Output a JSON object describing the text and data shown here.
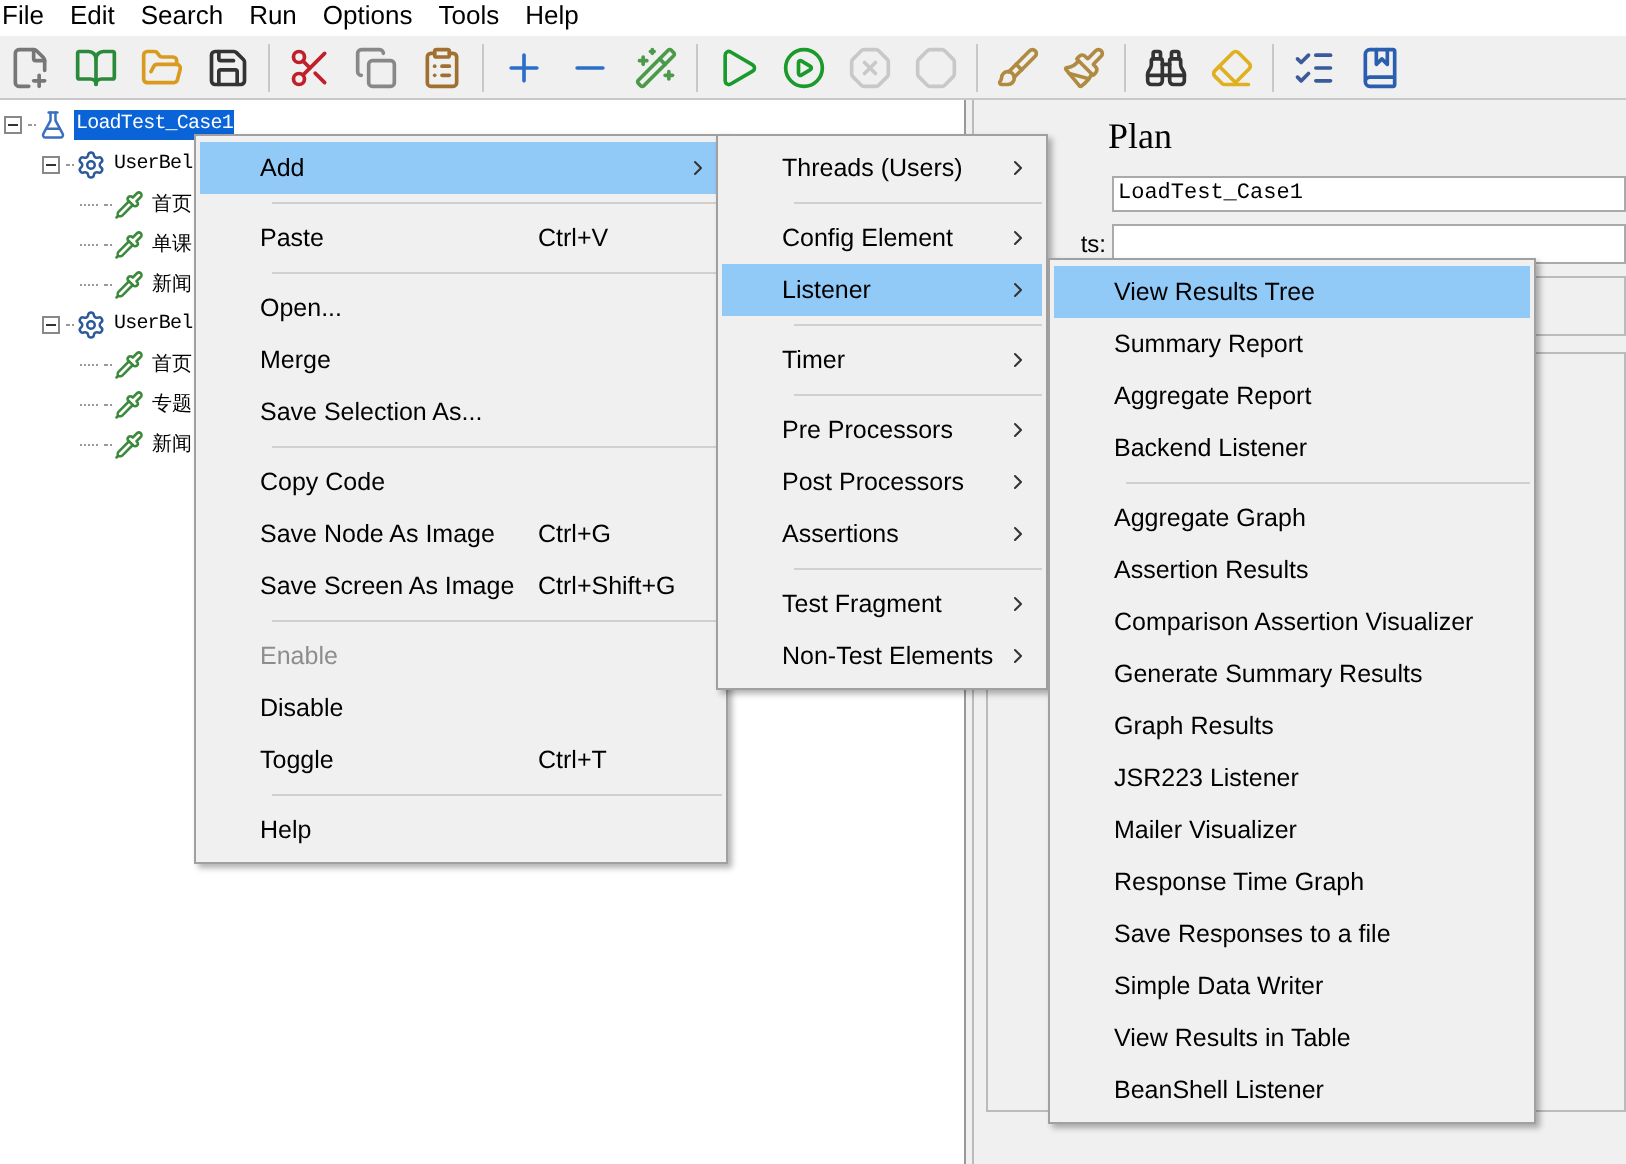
{
  "menubar": [
    "File",
    "Edit",
    "Search",
    "Run",
    "Options",
    "Tools",
    "Help"
  ],
  "toolbar": [
    {
      "kind": "tool",
      "disabled": false
    },
    {
      "kind": "tool",
      "disabled": false
    },
    {
      "kind": "tool",
      "disabled": false
    },
    {
      "kind": "tool",
      "disabled": false
    },
    {
      "kind": "separator"
    },
    {
      "kind": "tool",
      "disabled": false
    },
    {
      "kind": "tool",
      "disabled": false
    },
    {
      "kind": "tool",
      "disabled": false
    },
    {
      "kind": "separator"
    },
    {
      "kind": "tool",
      "disabled": false
    },
    {
      "kind": "tool",
      "disabled": false
    },
    {
      "kind": "tool",
      "disabled": false
    },
    {
      "kind": "separator"
    },
    {
      "kind": "tool",
      "disabled": false
    },
    {
      "kind": "tool",
      "disabled": false
    },
    {
      "kind": "tool",
      "disabled": true
    },
    {
      "kind": "tool",
      "disabled": true
    },
    {
      "kind": "separator"
    },
    {
      "kind": "tool",
      "disabled": false
    },
    {
      "kind": "tool",
      "disabled": false
    },
    {
      "kind": "separator"
    },
    {
      "kind": "tool",
      "disabled": false
    },
    {
      "kind": "tool",
      "disabled": false
    },
    {
      "kind": "separator"
    },
    {
      "kind": "tool",
      "disabled": false
    },
    {
      "kind": "tool",
      "disabled": false
    }
  ],
  "tree": [
    {
      "label": "LoadTest_Case1",
      "kind": "plan",
      "selected": true,
      "expanded": true,
      "children": [
        {
          "label": "UserBel",
          "kind": "group",
          "selected": false,
          "expanded": true,
          "children": [
            {
              "label": "首页",
              "kind": "sampler",
              "selected": false
            },
            {
              "label": "单课",
              "kind": "sampler",
              "selected": false
            },
            {
              "label": "新闻",
              "kind": "sampler",
              "selected": false
            }
          ]
        },
        {
          "label": "UserBel",
          "kind": "group",
          "selected": false,
          "expanded": true,
          "children": [
            {
              "label": "首页",
              "kind": "sampler",
              "selected": false
            },
            {
              "label": "专题",
              "kind": "sampler",
              "selected": false
            },
            {
              "label": "新闻",
              "kind": "sampler",
              "selected": false
            }
          ]
        }
      ]
    }
  ],
  "right_panel": {
    "title": "Plan",
    "name_value": "LoadTest_Case1",
    "comments_label": "ts:"
  },
  "context_menu": [
    {
      "kind": "item",
      "label": "Add",
      "submenu": true,
      "selected": true,
      "disabled": false
    },
    {
      "kind": "separator"
    },
    {
      "kind": "item",
      "label": "Paste",
      "shortcut": "Ctrl+V",
      "selected": false,
      "disabled": false
    },
    {
      "kind": "separator"
    },
    {
      "kind": "item",
      "label": "Open...",
      "selected": false,
      "disabled": false
    },
    {
      "kind": "item",
      "label": "Merge",
      "selected": false,
      "disabled": false
    },
    {
      "kind": "item",
      "label": "Save Selection As...",
      "selected": false,
      "disabled": false
    },
    {
      "kind": "separator"
    },
    {
      "kind": "item",
      "label": "Copy Code",
      "selected": false,
      "disabled": false
    },
    {
      "kind": "item",
      "label": "Save Node As Image",
      "shortcut": "Ctrl+G",
      "selected": false,
      "disabled": false
    },
    {
      "kind": "item",
      "label": "Save Screen As Image",
      "shortcut": "Ctrl+Shift+G",
      "selected": false,
      "disabled": false
    },
    {
      "kind": "separator"
    },
    {
      "kind": "item",
      "label": "Enable",
      "selected": false,
      "disabled": true
    },
    {
      "kind": "item",
      "label": "Disable",
      "selected": false,
      "disabled": false
    },
    {
      "kind": "item",
      "label": "Toggle",
      "shortcut": "Ctrl+T",
      "selected": false,
      "disabled": false
    },
    {
      "kind": "separator"
    },
    {
      "kind": "item",
      "label": "Help",
      "selected": false,
      "disabled": false
    }
  ],
  "add_submenu": [
    {
      "kind": "item",
      "label": "Threads (Users)",
      "submenu": true,
      "selected": false,
      "disabled": false
    },
    {
      "kind": "separator"
    },
    {
      "kind": "item",
      "label": "Config Element",
      "submenu": true,
      "selected": false,
      "disabled": false
    },
    {
      "kind": "item",
      "label": "Listener",
      "submenu": true,
      "selected": true,
      "disabled": false
    },
    {
      "kind": "separator"
    },
    {
      "kind": "item",
      "label": "Timer",
      "submenu": true,
      "selected": false,
      "disabled": false
    },
    {
      "kind": "separator"
    },
    {
      "kind": "item",
      "label": "Pre Processors",
      "submenu": true,
      "selected": false,
      "disabled": false
    },
    {
      "kind": "item",
      "label": "Post Processors",
      "submenu": true,
      "selected": false,
      "disabled": false
    },
    {
      "kind": "item",
      "label": "Assertions",
      "submenu": true,
      "selected": false,
      "disabled": false
    },
    {
      "kind": "separator"
    },
    {
      "kind": "item",
      "label": "Test Fragment",
      "submenu": true,
      "selected": false,
      "disabled": false
    },
    {
      "kind": "item",
      "label": "Non-Test Elements",
      "submenu": true,
      "selected": false,
      "disabled": false
    }
  ],
  "listener_submenu": [
    {
      "kind": "item",
      "label": "View Results Tree",
      "selected": true,
      "disabled": false
    },
    {
      "kind": "item",
      "label": "Summary Report",
      "selected": false,
      "disabled": false
    },
    {
      "kind": "item",
      "label": "Aggregate Report",
      "selected": false,
      "disabled": false
    },
    {
      "kind": "item",
      "label": "Backend Listener",
      "selected": false,
      "disabled": false
    },
    {
      "kind": "separator"
    },
    {
      "kind": "item",
      "label": "Aggregate Graph",
      "selected": false,
      "disabled": false
    },
    {
      "kind": "item",
      "label": "Assertion Results",
      "selected": false,
      "disabled": false
    },
    {
      "kind": "item",
      "label": "Comparison Assertion Visualizer",
      "selected": false,
      "disabled": false
    },
    {
      "kind": "item",
      "label": "Generate Summary Results",
      "selected": false,
      "disabled": false
    },
    {
      "kind": "item",
      "label": "Graph Results",
      "selected": false,
      "disabled": false
    },
    {
      "kind": "item",
      "label": "JSR223 Listener",
      "selected": false,
      "disabled": false
    },
    {
      "kind": "item",
      "label": "Mailer Visualizer",
      "selected": false,
      "disabled": false
    },
    {
      "kind": "item",
      "label": "Response Time Graph",
      "selected": false,
      "disabled": false
    },
    {
      "kind": "item",
      "label": "Save Responses to a file",
      "selected": false,
      "disabled": false
    },
    {
      "kind": "item",
      "label": "Simple Data Writer",
      "selected": false,
      "disabled": false
    },
    {
      "kind": "item",
      "label": "View Results in Table",
      "selected": false,
      "disabled": false
    },
    {
      "kind": "item",
      "label": "BeanShell Listener",
      "selected": false,
      "disabled": false
    }
  ]
}
